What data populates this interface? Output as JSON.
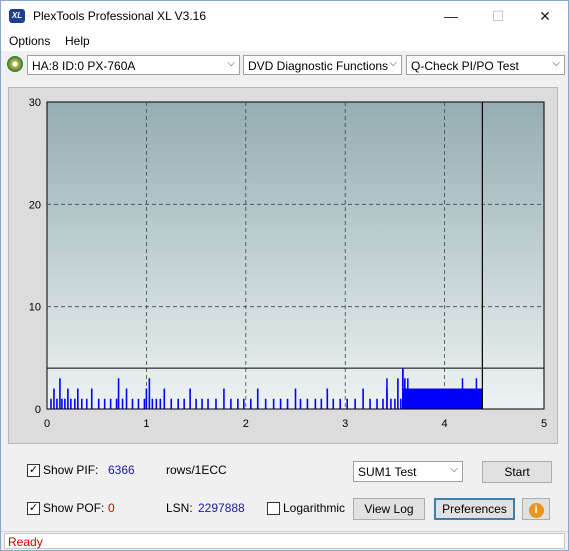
{
  "window": {
    "title": "PlexTools Professional XL V3.16",
    "icon_text": "XL",
    "min_glyph": "—",
    "max_glyph": "☐",
    "close_glyph": "✕"
  },
  "menu": {
    "options": "Options",
    "help": "Help"
  },
  "toolbar": {
    "drive": "HA:8 ID:0  PX-760A",
    "function": "DVD Diagnostic Functions",
    "test": "Q-Check PI/PO Test",
    "dropdown_glyph": "⌵"
  },
  "chart_data": {
    "type": "bar",
    "x_ticks": [
      "0",
      "1",
      "2",
      "3",
      "4",
      "5"
    ],
    "y_ticks": [
      "0",
      "10",
      "20",
      "30"
    ],
    "xlim": [
      0,
      5
    ],
    "ylim": [
      0,
      30
    ],
    "grid": true,
    "threshold_line": 4,
    "end_marker_x": 4.38,
    "series": [
      {
        "color": "#0000ff",
        "x": [
          0.04,
          0.07,
          0.1,
          0.13,
          0.15,
          0.18,
          0.21,
          0.24,
          0.28,
          0.31,
          0.35,
          0.4,
          0.45,
          0.52,
          0.58,
          0.64,
          0.7,
          0.72,
          0.76,
          0.8,
          0.86,
          0.92,
          0.98,
          1.0,
          1.03,
          1.06,
          1.1,
          1.14,
          1.18,
          1.25,
          1.32,
          1.38,
          1.44,
          1.5,
          1.56,
          1.62,
          1.7,
          1.78,
          1.85,
          1.92,
          1.98,
          2.05,
          2.12,
          2.2,
          2.28,
          2.35,
          2.42,
          2.5,
          2.55,
          2.62,
          2.7,
          2.76,
          2.82,
          2.88,
          2.95,
          3.02,
          3.1,
          3.18,
          3.25,
          3.32,
          3.38,
          3.42,
          3.46,
          3.5,
          3.53,
          3.56
        ],
        "values": [
          1,
          2,
          1,
          3,
          1,
          1,
          2,
          1,
          1,
          2,
          1,
          1,
          2,
          1,
          1,
          1,
          1,
          3,
          1,
          2,
          1,
          1,
          1,
          2,
          3,
          1,
          1,
          1,
          2,
          1,
          1,
          1,
          2,
          1,
          1,
          1,
          1,
          2,
          1,
          1,
          1,
          1,
          2,
          1,
          1,
          1,
          1,
          2,
          1,
          1,
          1,
          1,
          2,
          1,
          1,
          1,
          1,
          2,
          1,
          1,
          1,
          2,
          1,
          1,
          3,
          1
        ]
      },
      {
        "color": "#0000ff",
        "x": [
          3.58,
          3.6,
          3.62,
          3.64,
          3.66,
          3.68,
          3.7,
          3.72,
          3.75,
          3.8,
          3.85,
          3.9,
          3.95,
          4.0,
          4.05,
          4.1,
          4.15,
          4.2,
          4.25,
          4.3,
          4.35
        ],
        "values": [
          4,
          3,
          2,
          2,
          2,
          2,
          2,
          2,
          2,
          2,
          2,
          2,
          2,
          2,
          2,
          1,
          1,
          1,
          1,
          1,
          1
        ]
      }
    ],
    "peaks": {
      "x": [
        3.42,
        3.58,
        3.63,
        4.18,
        4.32
      ],
      "values": [
        3,
        4,
        3,
        3,
        3
      ]
    }
  },
  "controls": {
    "show_pif_label": "Show PIF:",
    "pif_value": "6366",
    "pif_unit": "rows/1ECC",
    "show_pof_label": "Show POF:",
    "pof_value": "0",
    "lsn_label": "LSN:",
    "lsn_value": "2297888",
    "logarithmic_label": "Logarithmic",
    "sum_select": "SUM1 Test",
    "start_label": "Start",
    "viewlog_label": "View Log",
    "preferences_label": "Preferences",
    "check_glyph": "✓",
    "info_glyph": "i"
  },
  "status": {
    "text": "Ready"
  },
  "colors": {
    "pif": "#1a1aa0",
    "pof": "#cc0000",
    "status": "#d40000",
    "bars": "#0000ff"
  }
}
